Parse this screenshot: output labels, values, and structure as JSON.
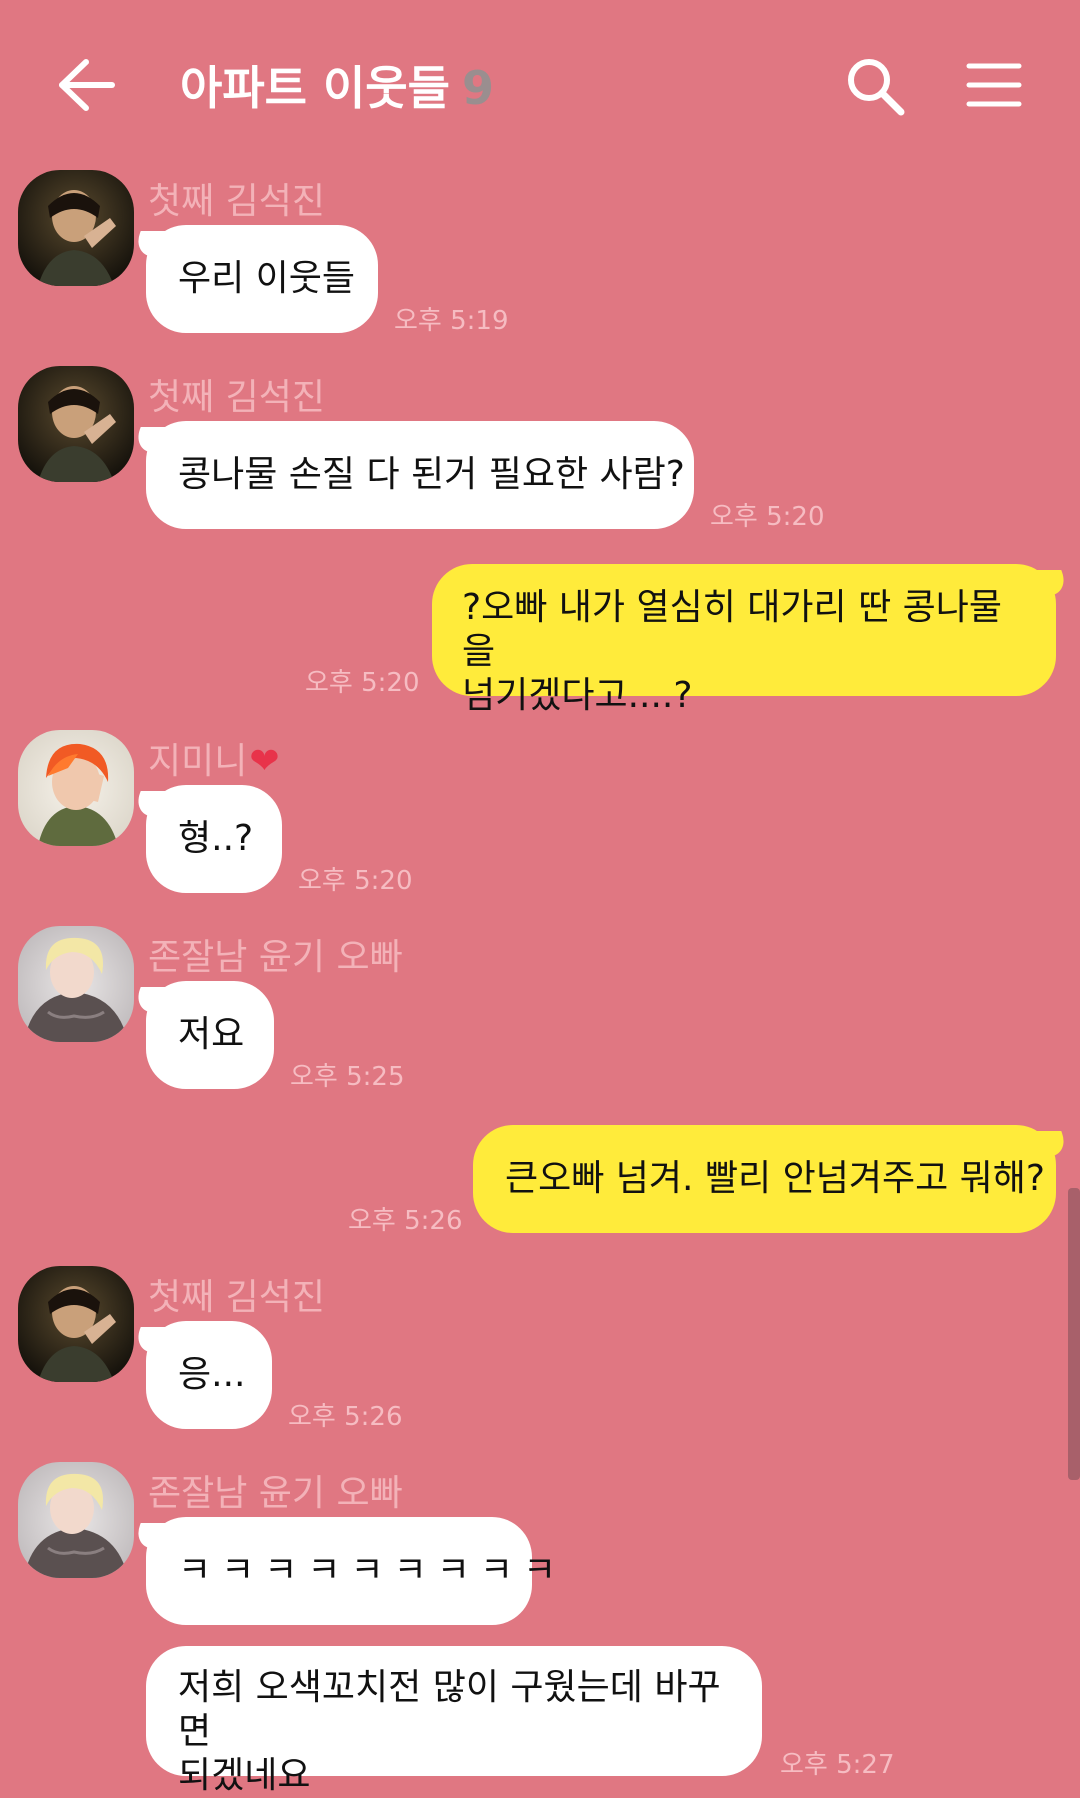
{
  "header": {
    "title": "아파트 이웃들",
    "member_count": "9",
    "back_icon": "arrow-left-icon",
    "search_icon": "search-icon",
    "menu_icon": "hamburger-menu-icon"
  },
  "messages": [
    {
      "type": "in",
      "sender": "첫째 김석진",
      "text": "우리 이웃들",
      "time": "오후 5:19"
    },
    {
      "type": "in",
      "sender": "첫째 김석진",
      "text": "콩나물 손질 다 된거 필요한 사람?",
      "time": "오후 5:20"
    },
    {
      "type": "out",
      "line1": "?오빠 내가 열심히 대가리 딴 콩나물을",
      "line2": "넘기겠다고....?",
      "time": "오후 5:20"
    },
    {
      "type": "in",
      "sender": "지미니",
      "sender_suffix": "❤",
      "text": "형..?",
      "time": "오후 5:20"
    },
    {
      "type": "in",
      "sender": "존잘남 윤기 오빠",
      "text": "저요",
      "time": "오후 5:25"
    },
    {
      "type": "out",
      "text": "큰오빠 넘겨. 빨리 안넘겨주고 뭐해?",
      "time": "오후 5:26"
    },
    {
      "type": "in",
      "sender": "첫째 김석진",
      "text": "응...",
      "time": "오후 5:26"
    },
    {
      "type": "in",
      "sender": "존잘남 윤기 오빠",
      "text": "ㅋㅋㅋㅋㅋㅋㅋㅋㅋ"
    },
    {
      "type": "in",
      "line1": "저희 오색꼬치전 많이 구웠는데 바꾸면",
      "line2": "되겠네요",
      "time": "오후 5:27"
    }
  ]
}
